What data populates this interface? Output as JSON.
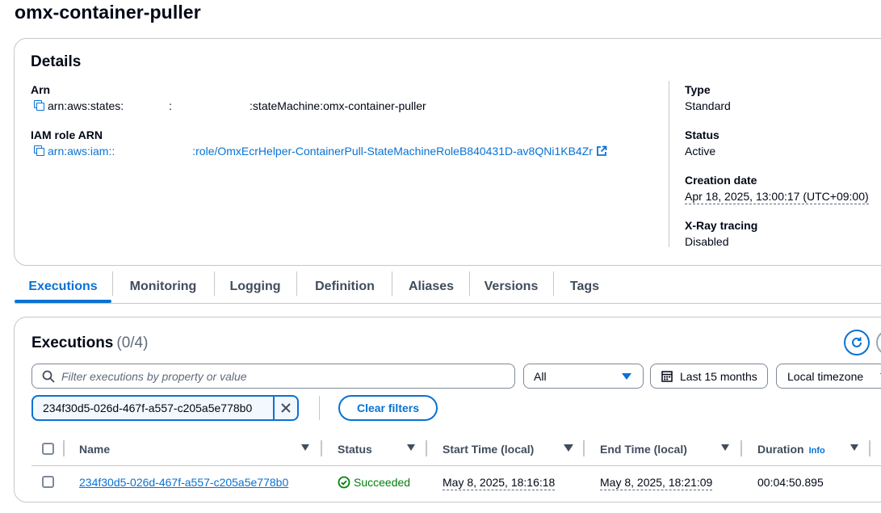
{
  "page": {
    "title": "omx-container-puller"
  },
  "details": {
    "heading": "Details",
    "arn": {
      "label": "Arn",
      "prefix": "arn:aws:states:",
      "colon": ":",
      "suffix": ":stateMachine:omx-container-puller"
    },
    "iam_role": {
      "label": "IAM role ARN",
      "prefix": "arn:aws:iam::",
      "suffix": ":role/OmxEcrHelper-ContainerPull-StateMachineRoleB840431D-av8QNi1KB4Zr"
    },
    "type": {
      "label": "Type",
      "value": "Standard"
    },
    "status": {
      "label": "Status",
      "value": "Active"
    },
    "creation_date": {
      "label": "Creation date",
      "value": "Apr 18, 2025, 13:00:17 (UTC+09:00)"
    },
    "xray": {
      "label": "X-Ray tracing",
      "value": "Disabled"
    }
  },
  "tabs": [
    {
      "label": "Executions",
      "active": true
    },
    {
      "label": "Monitoring"
    },
    {
      "label": "Logging"
    },
    {
      "label": "Definition"
    },
    {
      "label": "Aliases"
    },
    {
      "label": "Versions"
    },
    {
      "label": "Tags"
    }
  ],
  "executions": {
    "heading": "Executions",
    "count": "(0/4)",
    "filter_placeholder": "Filter executions by property or value",
    "status_filter": "All",
    "date_range": "Last 15 months",
    "timezone": "Local timezone",
    "token": "234f30d5-026d-467f-a557-c205a5e778b0",
    "clear_filters": "Clear filters",
    "columns": {
      "name": "Name",
      "status": "Status",
      "start": "Start Time (local)",
      "end": "End Time (local)",
      "duration": "Duration",
      "info": "Info"
    },
    "rows": [
      {
        "name": "234f30d5-026d-467f-a557-c205a5e778b0",
        "status": "Succeeded",
        "start": "May 8, 2025, 18:16:18",
        "end": "May 8, 2025, 18:21:09",
        "duration": "00:04:50.895"
      }
    ]
  },
  "colors": {
    "accent": "#0972d3",
    "success": "#037f0c",
    "text": "#000716",
    "border": "#c6c6cd"
  }
}
